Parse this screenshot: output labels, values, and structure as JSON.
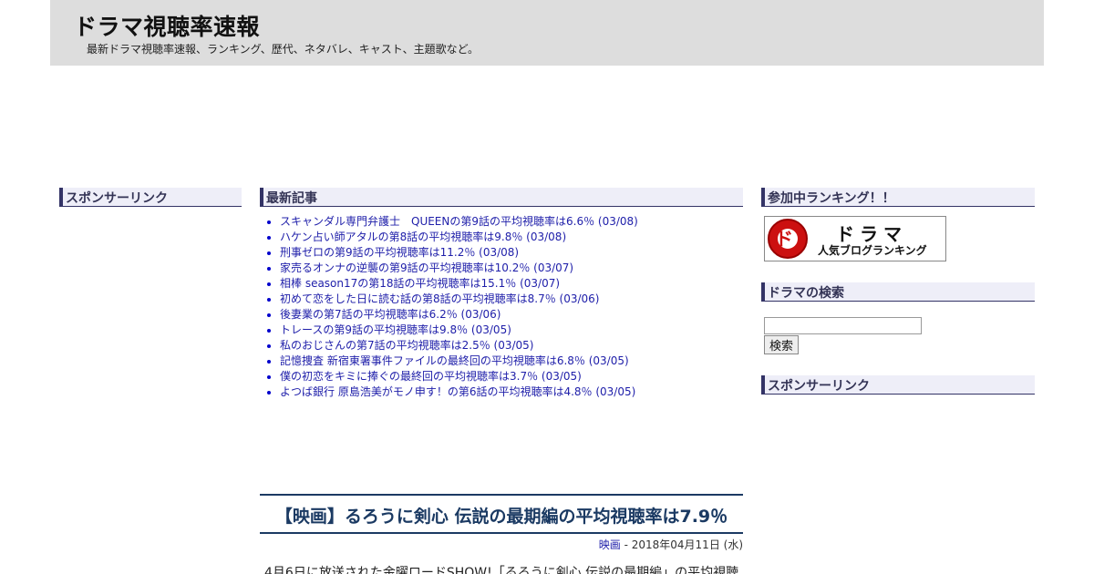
{
  "header": {
    "title": "ドラマ視聴率速報",
    "description": "最新ドラマ視聴率速報、ランキング、歴代、ネタバレ、キャスト、主題歌など。"
  },
  "left": {
    "sponsor_title": "スポンサーリンク"
  },
  "recent": {
    "title": "最新記事",
    "items": [
      "スキャンダル専門弁護士　QUEENの第9話の平均視聴率は6.6％ (03/08)",
      "ハケン占い師アタルの第8話の平均視聴率は9.8％ (03/08)",
      "刑事ゼロの第9話の平均視聴率は11.2％ (03/08)",
      "家売るオンナの逆襲の第9話の平均視聴率は10.2％ (03/07)",
      "相棒 season17の第18話の平均視聴率は15.1％ (03/07)",
      "初めて恋をした日に読む話の第8話の平均視聴率は8.7％ (03/06)",
      "後妻業の第7話の平均視聴率は6.2％ (03/06)",
      "トレースの第9話の平均視聴率は9.8％ (03/05)",
      "私のおじさんの第7話の平均視聴率は2.5％ (03/05)",
      "記憶捜査 新宿東署事件ファイルの最終回の平均視聴率は6.8％ (03/05)",
      "僕の初恋をキミに捧ぐの最終回の平均視聴率は3.7％ (03/05)",
      "よつば銀行 原島浩美がモノ申す！の第6話の平均視聴率は4.8％ (03/05)"
    ]
  },
  "article": {
    "title": "【映画】るろうに剣心 伝説の最期編の平均視聴率は7.9％",
    "category": "映画",
    "date": " - 2018年04月11日 (水)",
    "body": "4月6日に放送された金曜ロードSHOW!「るろうに剣心 伝説の最期編」の平均視聴"
  },
  "right": {
    "ranking_title": "参加中ランキング！！",
    "banner_mark": "ド",
    "banner_main": "ドラマ",
    "banner_sub": "人気ブログランキング",
    "search_title": "ドラマの検索",
    "search_value": "",
    "search_button": "検索",
    "sponsor_title": "スポンサーリンク"
  }
}
